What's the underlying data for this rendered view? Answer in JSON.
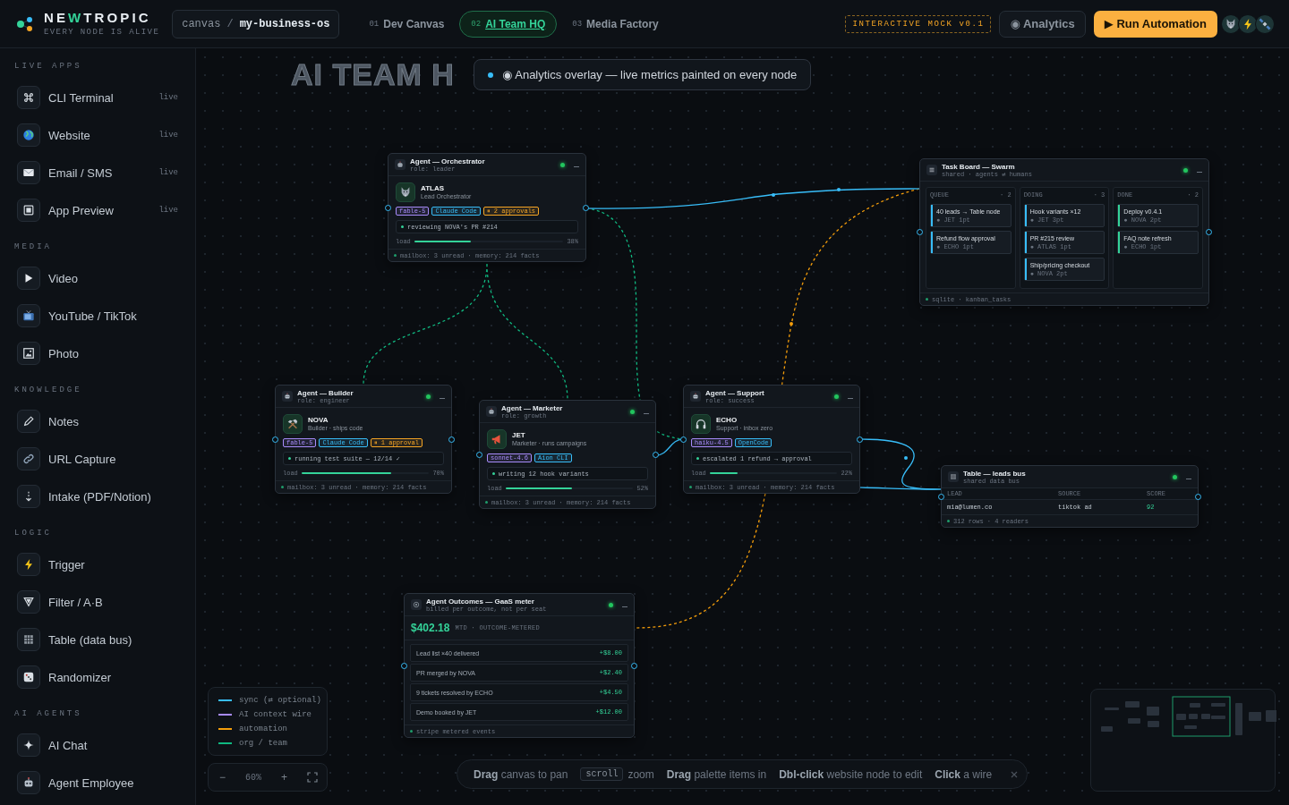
{
  "header": {
    "brand": [
      {
        "text": "NE",
        "accent": false
      },
      {
        "text": "W",
        "accent": true
      },
      {
        "text": "TROPIC",
        "accent": false
      }
    ],
    "tagline": "EVERY NODE IS ALIVE",
    "breadcrumb": {
      "root": "canvas",
      "separator": "/",
      "current": "my-business-os"
    },
    "tabs": [
      {
        "number": "01",
        "label": "Dev Canvas",
        "selected": false
      },
      {
        "number": "02",
        "label": "AI Team HQ",
        "selected": true
      },
      {
        "number": "03",
        "label": "Media Factory",
        "selected": false
      }
    ],
    "badge": "INTERACTIVE MOCK v0.1",
    "analytics_button": "◉ Analytics",
    "run_button": "▶ Run Automation"
  },
  "sidebar": {
    "sections": [
      {
        "title": "LIVE APPS",
        "items": [
          {
            "label": "CLI Terminal",
            "badge": "live"
          },
          {
            "label": "Website",
            "badge": "live"
          },
          {
            "label": "Email / SMS",
            "badge": "live"
          },
          {
            "label": "App Preview",
            "badge": "live"
          }
        ]
      },
      {
        "title": "MEDIA",
        "items": [
          {
            "label": "Video"
          },
          {
            "label": "YouTube / TikTok"
          },
          {
            "label": "Photo"
          }
        ]
      },
      {
        "title": "KNOWLEDGE",
        "items": [
          {
            "label": "Notes"
          },
          {
            "label": "URL Capture"
          },
          {
            "label": "Intake (PDF/Notion)"
          }
        ]
      },
      {
        "title": "LOGIC",
        "items": [
          {
            "label": "Trigger"
          },
          {
            "label": "Filter / A·B"
          },
          {
            "label": "Table (data bus)"
          },
          {
            "label": "Randomizer"
          }
        ]
      },
      {
        "title": "AI AGENTS",
        "items": [
          {
            "label": "AI Chat"
          },
          {
            "label": "Agent Employee"
          }
        ]
      }
    ]
  },
  "canvas": {
    "title": "AI TEAM H",
    "banner": "◉ Analytics overlay — live metrics painted on every node",
    "nodes": [
      {
        "kind": "agent",
        "title": "Agent — Orchestrator",
        "subtitle": "role: leader",
        "online": true,
        "name": "ATLAS",
        "role": "Lead Orchestrator",
        "tags": [
          {
            "text": "fable-5",
            "color": "#a78bfa"
          },
          {
            "text": "Claude Code",
            "color": "#38bdf8"
          },
          {
            "text": "⏸ 2 approvals",
            "color": "#f5a524"
          }
        ],
        "activity": "reviewing NOVA's PR #214",
        "load_label": "load",
        "level": 0.38,
        "load_value": "38%",
        "footer": "mailbox: 3 unread · memory: 214 facts"
      },
      {
        "kind": "board",
        "title": "Task Board — Swarm",
        "subtitle": "shared · agents ⇄ humans",
        "online": true,
        "columns": [
          {
            "title": "QUEUE",
            "count": "· 2",
            "color": "#38bdf8",
            "cards": [
              {
                "title": "40 leads → Table node",
                "meta": "● JET 1pt"
              },
              {
                "title": "Refund flow approval",
                "meta": "● ECHO 1pt"
              }
            ]
          },
          {
            "title": "DOING",
            "count": "· 3",
            "color": "#38bdf8",
            "cards": [
              {
                "title": "Hook variants ×12",
                "meta": "● JET 3pt"
              },
              {
                "title": "PR #215 review",
                "meta": "● ATLAS 1pt"
              },
              {
                "title": "Ship/pricing checkout",
                "meta": "● NOVA 2pt"
              }
            ]
          },
          {
            "title": "DONE",
            "count": "· 2",
            "color": "#34d399",
            "cards": [
              {
                "title": "Deploy v0.4.1",
                "meta": "● NOVA 2pt"
              },
              {
                "title": "FAQ note refresh",
                "meta": "● ECHO 1pt"
              }
            ]
          }
        ],
        "footer": "sqlite · kanban_tasks"
      },
      {
        "kind": "agent",
        "title": "Agent — Builder",
        "subtitle": "role: engineer",
        "online": true,
        "name": "NOVA",
        "role": "Builder · ships code",
        "tags": [
          {
            "text": "fable-5",
            "color": "#a78bfa"
          },
          {
            "text": "Claude Code",
            "color": "#38bdf8"
          },
          {
            "text": "⏸ 1 approval",
            "color": "#f5a524"
          }
        ],
        "activity": "running test suite — 12/14 ✓",
        "load_label": "load",
        "level": 0.7,
        "load_value": "70%",
        "footer": "mailbox: 3 unread · memory: 214 facts"
      },
      {
        "kind": "agent",
        "title": "Agent — Marketer",
        "subtitle": "role: growth",
        "online": true,
        "name": "JET",
        "role": "Marketer · runs campaigns",
        "tags": [
          {
            "text": "sonnet-4.6",
            "color": "#a78bfa"
          },
          {
            "text": "Aion CLI",
            "color": "#38bdf8"
          }
        ],
        "activity": "writing 12 hook variants",
        "load_label": "load",
        "level": 0.52,
        "load_value": "52%",
        "footer": "mailbox: 3 unread · memory: 214 facts"
      },
      {
        "kind": "agent",
        "title": "Agent — Support",
        "subtitle": "role: success",
        "online": true,
        "name": "ECHO",
        "role": "Support · inbox zero",
        "tags": [
          {
            "text": "haiku-4.5",
            "color": "#a78bfa"
          },
          {
            "text": "OpenCode",
            "color": "#38bdf8"
          }
        ],
        "activity": "escalated 1 refund → approval",
        "load_label": "load",
        "level": 0.22,
        "load_value": "22%",
        "footer": "mailbox: 3 unread · memory: 214 facts"
      },
      {
        "kind": "table",
        "title": "Table — leads bus",
        "subtitle": "shared data bus",
        "online": true,
        "columns": [
          "LEAD",
          "SOURCE",
          "SCORE"
        ],
        "rows": [
          [
            "mia@lumen.co",
            "tiktok ad",
            "92"
          ]
        ],
        "footer": "312 rows · 4 readers"
      },
      {
        "kind": "meter",
        "title": "Agent Outcomes — GaaS meter",
        "subtitle": "billed per outcome, not per seat",
        "online": true,
        "total": "$402.18",
        "total_caption": "MTD · OUTCOME-METERED",
        "rows": [
          {
            "label": "Lead list ×40 delivered",
            "amount": "+$8.00"
          },
          {
            "label": "PR merged by NOVA",
            "amount": "+$2.40"
          },
          {
            "label": "9 tickets resolved by ECHO",
            "amount": "+$4.50"
          },
          {
            "label": "Demo booked by JET",
            "amount": "+$12.00"
          }
        ],
        "footer": "stripe metered events"
      }
    ],
    "legend": [
      {
        "label": "sync (⇄ optional)",
        "color": "#38bdf8"
      },
      {
        "label": "AI context wire",
        "color": "#a78bfa"
      },
      {
        "label": "automation",
        "color": "#f59e0b"
      },
      {
        "label": "org / team",
        "color": "#10b981"
      }
    ],
    "zoom": {
      "out": "−",
      "value": "60%",
      "in": "+"
    },
    "hints": [
      {
        "text": "**Drag** canvas to pan"
      },
      {
        "key": "scroll",
        "text": "zoom"
      },
      {
        "text": "**Drag** palette items in"
      },
      {
        "text": "**Dbl-click** website node to edit"
      },
      {
        "text": "**Click** a wire"
      }
    ]
  }
}
